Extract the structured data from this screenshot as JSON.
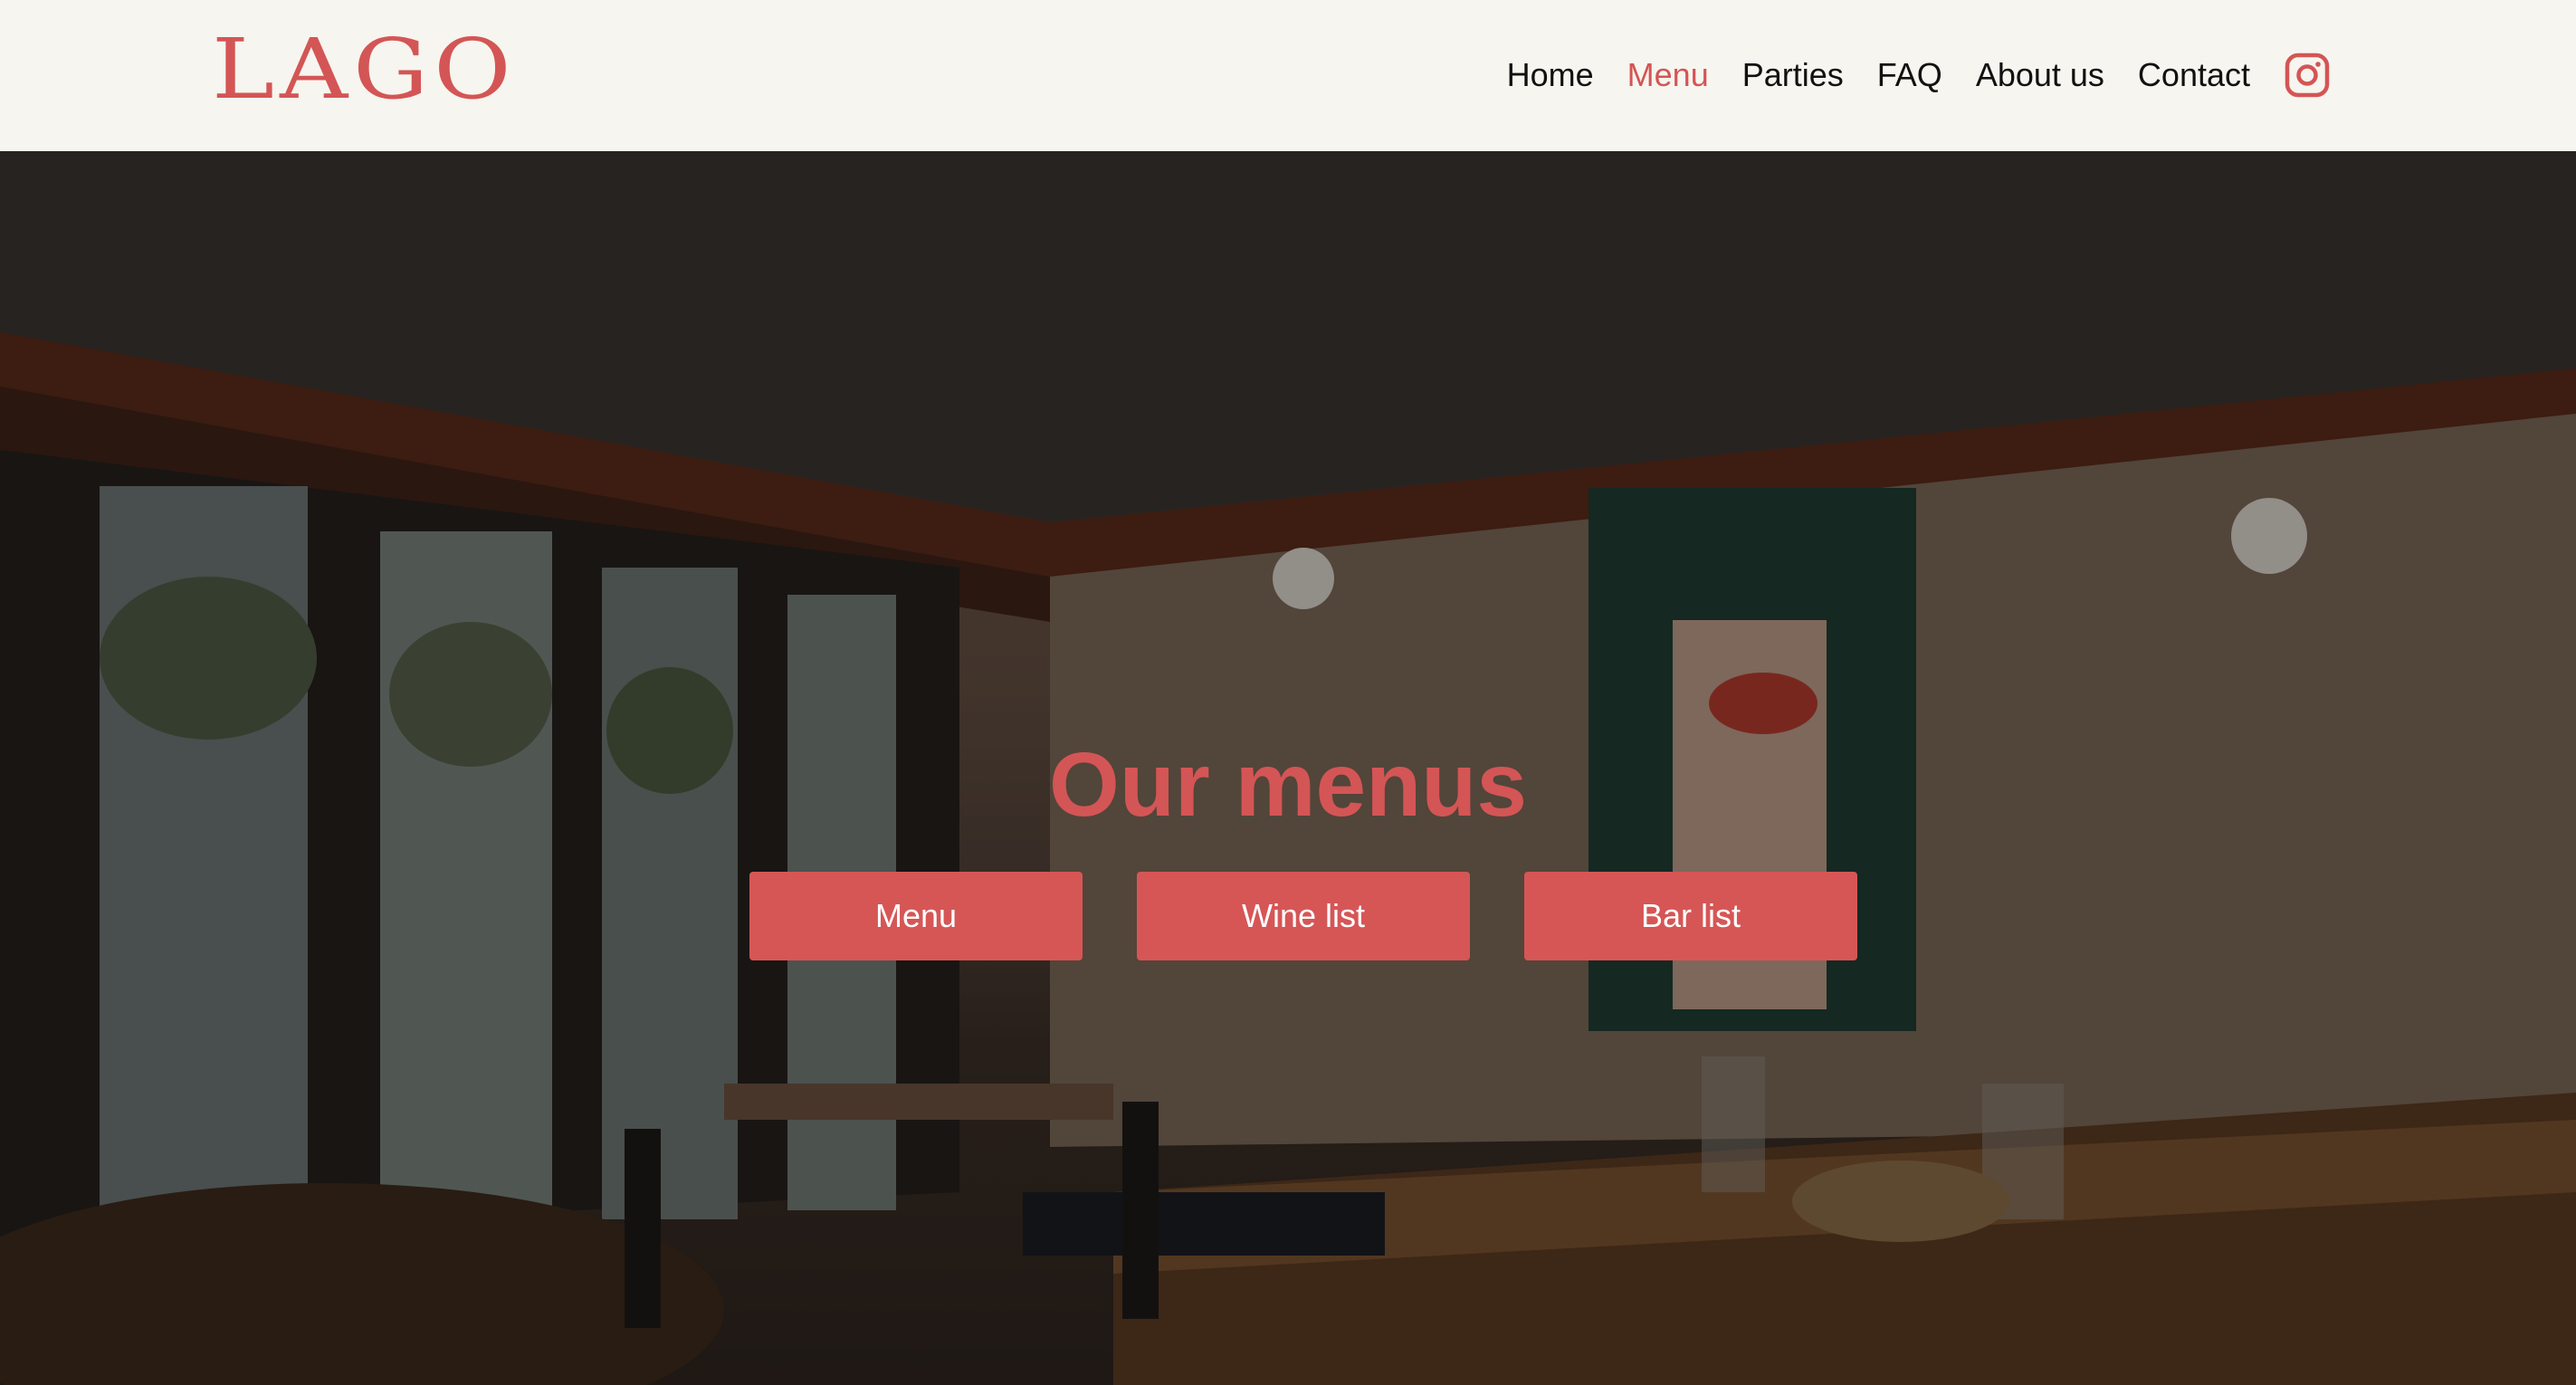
{
  "brand": {
    "logo_text": "LAGO",
    "accent_color": "#d45555"
  },
  "nav": {
    "items": [
      {
        "label": "Home",
        "active": false
      },
      {
        "label": "Menu",
        "active": true
      },
      {
        "label": "Parties",
        "active": false
      },
      {
        "label": "FAQ",
        "active": false
      },
      {
        "label": "About us",
        "active": false
      },
      {
        "label": "Contact",
        "active": false
      }
    ],
    "social_icon": "instagram-icon"
  },
  "hero": {
    "title": "Our menus",
    "buttons": [
      {
        "label": "Menu"
      },
      {
        "label": "Wine list"
      },
      {
        "label": "Bar list"
      }
    ],
    "background": "restaurant-dining-room-photo"
  }
}
